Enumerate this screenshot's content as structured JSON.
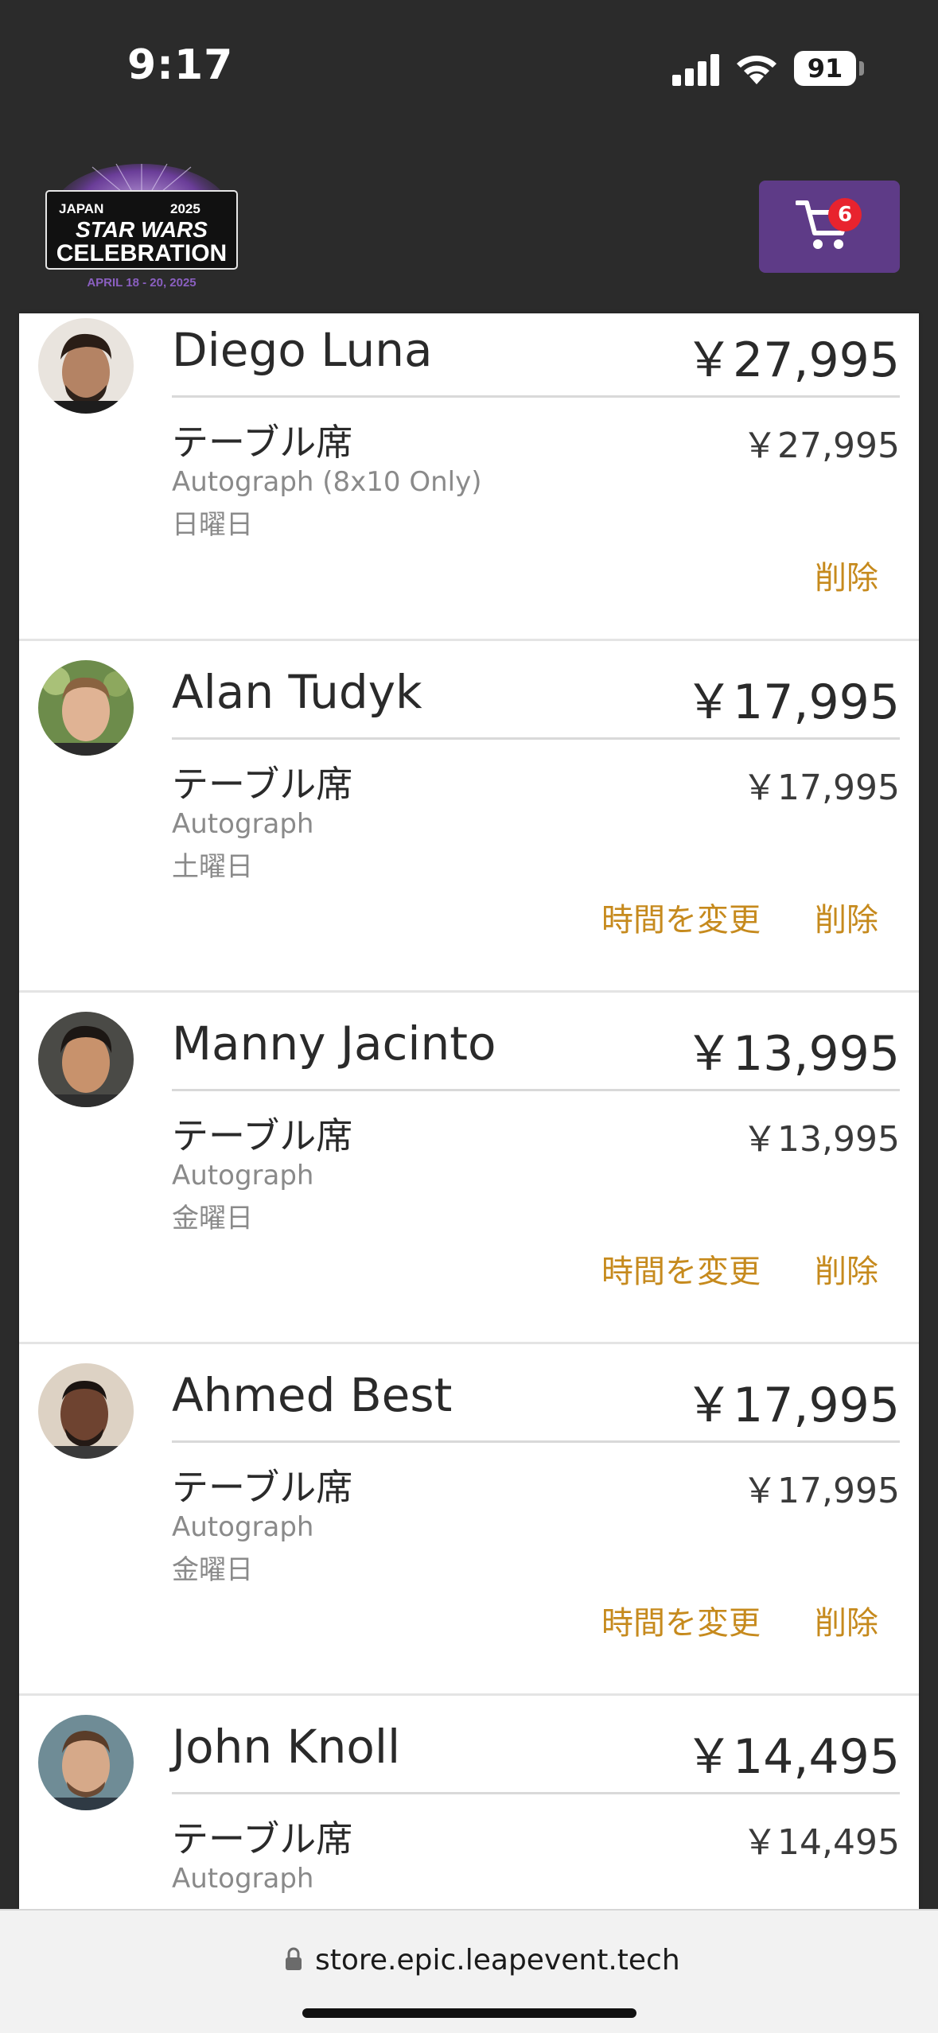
{
  "status_bar": {
    "time": "9:17",
    "battery": "91"
  },
  "header": {
    "logo_alt": "Star Wars Celebration Japan 2025",
    "logo_top_left": "JAPAN",
    "logo_top_right": "2025",
    "logo_line1": "STAR WARS",
    "logo_line2": "CELEBRATION",
    "logo_dates": "APRIL 18 - 20, 2025",
    "cart_count": "6",
    "brand_color": "#5e3b87",
    "badge_color": "#e8232e"
  },
  "cart_items": [
    {
      "name": "Diego Luna",
      "total": "￥27,995",
      "seat": "テーブル席",
      "line_price": "￥27,995",
      "variant": "Autograph (8x10 Only)",
      "day": "日曜日",
      "change_time_label": "",
      "remove_label": "削除"
    },
    {
      "name": "Alan Tudyk",
      "total": "￥17,995",
      "seat": "テーブル席",
      "line_price": "￥17,995",
      "variant": "Autograph",
      "day": "土曜日",
      "change_time_label": "時間を変更",
      "remove_label": "削除"
    },
    {
      "name": "Manny Jacinto",
      "total": "￥13,995",
      "seat": "テーブル席",
      "line_price": "￥13,995",
      "variant": "Autograph",
      "day": "金曜日",
      "change_time_label": "時間を変更",
      "remove_label": "削除"
    },
    {
      "name": "Ahmed Best",
      "total": "￥17,995",
      "seat": "テーブル席",
      "line_price": "￥17,995",
      "variant": "Autograph",
      "day": "金曜日",
      "change_time_label": "時間を変更",
      "remove_label": "削除"
    },
    {
      "name": "John Knoll",
      "total": "￥14,495",
      "seat": "テーブル席",
      "line_price": "￥14,495",
      "variant": "Autograph",
      "day": "",
      "change_time_label": "",
      "remove_label": ""
    }
  ],
  "browser": {
    "url": "store.epic.leapevent.tech"
  },
  "colors": {
    "action_text": "#c68a1d",
    "background_dark": "#2b2b2b"
  }
}
